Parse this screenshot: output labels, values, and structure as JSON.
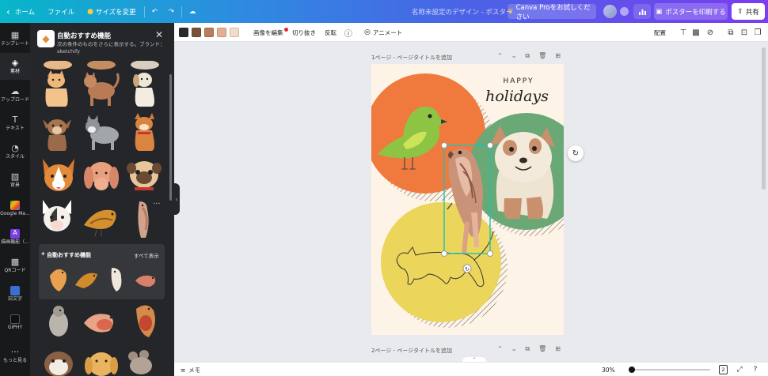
{
  "topbar": {
    "home": "ホーム",
    "file": "ファイル",
    "resize": "サイズを変更",
    "doc_title": "名称未設定のデザイン - ポスター",
    "pro_cta": "Canva Proをお試しください",
    "print": "ポスターを印刷する",
    "share": "共有",
    "brand_gradient": [
      "#08b6c9",
      "#7a3df0"
    ]
  },
  "rail": {
    "items": [
      {
        "label": "テンプレート",
        "icon": "template-icon"
      },
      {
        "label": "素材",
        "icon": "elements-icon"
      },
      {
        "label": "アップロード",
        "icon": "upload-icon"
      },
      {
        "label": "テキスト",
        "icon": "text-icon"
      },
      {
        "label": "スタイル",
        "icon": "style-icon"
      },
      {
        "label": "背景",
        "icon": "background-icon"
      },
      {
        "label": "Google Ma...",
        "icon": "google-maps-icon"
      },
      {
        "label": "描画機能（...",
        "icon": "draw-icon"
      },
      {
        "label": "QRコード",
        "icon": "qr-code-icon"
      },
      {
        "label": "旧文字",
        "icon": "old-text-icon"
      },
      {
        "label": "GIPHY",
        "icon": "giphy-icon"
      },
      {
        "label": "もっと見る",
        "icon": "more-icon"
      }
    ]
  },
  "panel": {
    "title": "自動おすすめ機能",
    "desc": "次の条件のものをさらに表示する。ブランド：sketchify",
    "section_title": "自動おすすめ機能",
    "section_all": "すべて表示"
  },
  "toolbar": {
    "swatches": [
      "#2a2a2a",
      "#7a5238",
      "#b97d5d",
      "#e5ae8f",
      "#f1dcc6"
    ],
    "edit_image": "画像を編集",
    "crop": "切り抜き",
    "flip": "反転",
    "animate": "アニメート",
    "arrange": "配置"
  },
  "canvas": {
    "page1_label": "1ページ - ページタイトルを追加",
    "page2_label": "2ページ - ページタイトルを追加",
    "poster": {
      "happy": "HAPPY",
      "holidays": "holidays",
      "colors": {
        "bg": "#fdf3e6",
        "orange": "#f07a3e",
        "green": "#6aa876",
        "yellow": "#ebd55a",
        "selection": "#1fc2b6"
      }
    }
  },
  "bottom": {
    "notes": "メモ",
    "zoom": "30%",
    "page_count": "2"
  }
}
